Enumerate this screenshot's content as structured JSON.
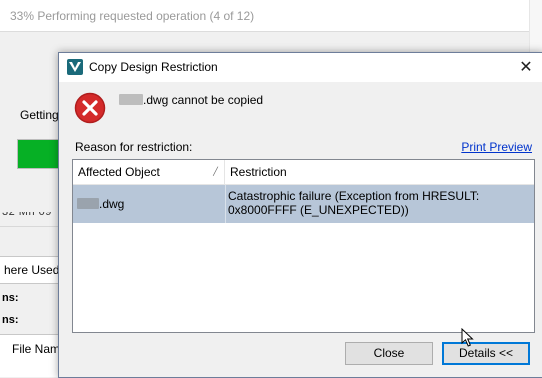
{
  "background": {
    "title": "33% Performing requested operation (4 of 12)",
    "getting_label": "Getting",
    "meta_text": "32 Mh 09",
    "tab_label": "here Used",
    "row1_label": "ns:",
    "row2_label": "ns:",
    "list_header": "File Nam",
    "progress_color": "#06b025"
  },
  "dialog": {
    "title": "Copy Design Restriction",
    "app_icon": "autodesk-vault-icon",
    "close_symbol": "✕",
    "error_icon": "error-icon",
    "error_message_suffix": ".dwg cannot be copied",
    "reason_label": "Reason for restriction:",
    "print_preview_link": "Print Preview",
    "table": {
      "columns": [
        "Affected Object",
        "Restriction"
      ],
      "rows": [
        {
          "object_suffix": ".dwg",
          "restriction": "Catastrophic failure (Exception from HRESULT: 0x8000FFFF (E_UNEXPECTED))"
        }
      ]
    },
    "buttons": {
      "close": "Close",
      "details": "Details <<"
    },
    "colors": {
      "selected_row": "#b7c6d8",
      "error_red": "#d42a2a",
      "link": "#0033cc",
      "accent": "#0078d7"
    }
  }
}
